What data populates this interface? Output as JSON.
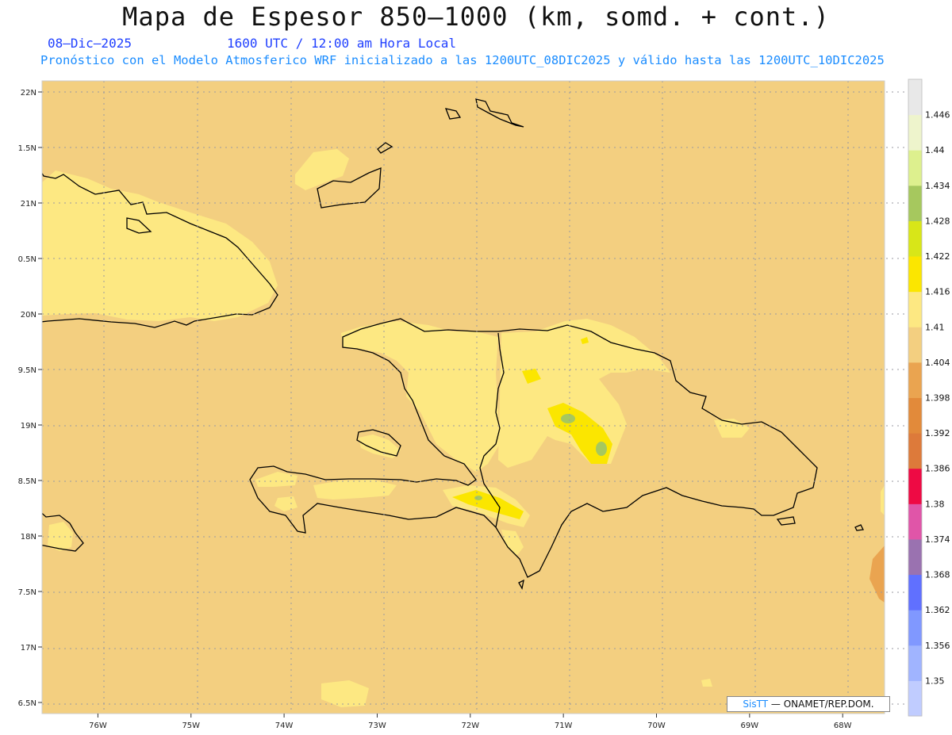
{
  "header": {
    "title": "Mapa de Espesor 850—1000 (km, somd. + cont.)",
    "date": "08—Dic—2025",
    "time": "1600 UTC / 12:00 am Hora Local",
    "model_line": "Pronóstico con el Modelo Atmosferico WRF inicializado a las 1200UTC_08DIC2025 y válido hasta las  1200UTC_10DIC2025"
  },
  "axes": {
    "lon_labels": [
      "76W",
      "75W",
      "74W",
      "73W",
      "72W",
      "71W",
      "70W",
      "69W",
      "68W"
    ],
    "lon_values": [
      -76,
      -75,
      -74,
      -73,
      -72,
      -71,
      -70,
      -69,
      -68
    ],
    "lat_labels": [
      "22N",
      "1.5N",
      "21N",
      "0.5N",
      "20N",
      "9.5N",
      "19N",
      "8.5N",
      "18N",
      "7.5N",
      "17N",
      "6.5N"
    ],
    "lat_values": [
      22,
      21.5,
      21,
      20.5,
      20,
      19.5,
      19,
      18.5,
      18,
      17.5,
      17,
      16.5
    ],
    "lon_range": [
      -76.6,
      -67.55
    ],
    "lat_range": [
      16.4,
      22.1
    ]
  },
  "colorbar": {
    "levels": [
      "1.35",
      "1.356",
      "1.362",
      "1.368",
      "1.374",
      "1.38",
      "1.386",
      "1.392",
      "1.398",
      "1.404",
      "1.41",
      "1.416",
      "1.422",
      "1.428",
      "1.434",
      "1.44",
      "1.446"
    ],
    "colors": [
      "#c0ccff",
      "#a0b4ff",
      "#8098ff",
      "#6070ff",
      "#9a72b0",
      "#e055a8",
      "#ee0a44",
      "#dd7a3a",
      "#e28a3a",
      "#eaa450",
      "#f3cf80",
      "#fde882",
      "#fbe600",
      "#d8e618",
      "#a6c85e",
      "#ddf08e",
      "#eef4cc",
      "#e8e8e8"
    ]
  },
  "colors": {
    "base_fill": "#f3cf80",
    "level_1410": "#fde882",
    "level_1416": "#fbe600",
    "level_1428": "#a6c85e",
    "level_1398": "#eaa450",
    "coastline": "#000000"
  },
  "credit": {
    "brand": "SisTT",
    "org": "— ONAMET/REP.DOM."
  }
}
